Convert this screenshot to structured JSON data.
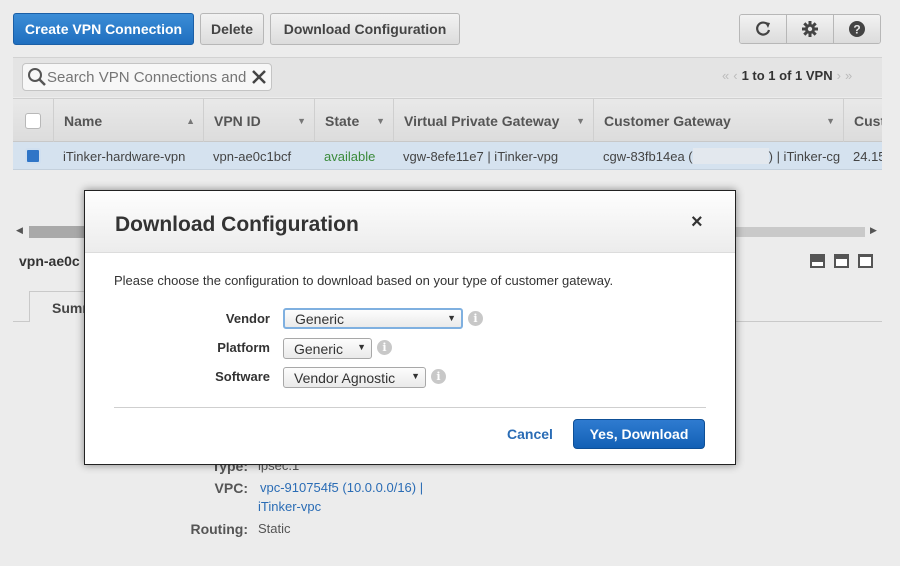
{
  "toolbar": {
    "create_label": "Create VPN Connection",
    "delete_label": "Delete",
    "download_label": "Download Configuration"
  },
  "filter": {
    "search_placeholder": "Search VPN Connections and",
    "pager_text": "1 to 1 of 1 VPN"
  },
  "table": {
    "columns": [
      "Name",
      "VPN ID",
      "State",
      "Virtual Private Gateway",
      "Customer Gateway",
      "Cust"
    ],
    "row": {
      "name": "iTinker-hardware-vpn",
      "vpn_id": "vpn-ae0c1bcf",
      "state": "available",
      "vpg": "vgw-8efe11e7 | iTinker-vpg",
      "cgw_prefix": "cgw-83fb14ea (",
      "cgw_suffix": ") | iTinker-cg",
      "cust": "24.15"
    }
  },
  "detail": {
    "title": "vpn-ae0c",
    "tab_summary": "Summ",
    "type_label": "Type:",
    "type_value": "ipsec.1",
    "vpc_label": "VPC:",
    "vpc_value_1": "vpc-910754f5 (10.0.0.0/16) |",
    "vpc_value_2": "iTinker-vpc",
    "routing_label": "Routing:",
    "routing_value": "Static"
  },
  "modal": {
    "title": "Download Configuration",
    "close_symbol": "×",
    "description": "Please choose the configuration to download based on your type of customer gateway.",
    "vendor_label": "Vendor",
    "vendor_value": "Generic",
    "platform_label": "Platform",
    "platform_value": "Generic",
    "software_label": "Software",
    "software_value": "Vendor Agnostic",
    "cancel_label": "Cancel",
    "confirm_label": "Yes, Download"
  },
  "colors": {
    "primary_button": "#1f6fbf",
    "state_available": "#3a8a3a",
    "link": "#2a6cb5",
    "selected_row": "#d5e2ef"
  }
}
